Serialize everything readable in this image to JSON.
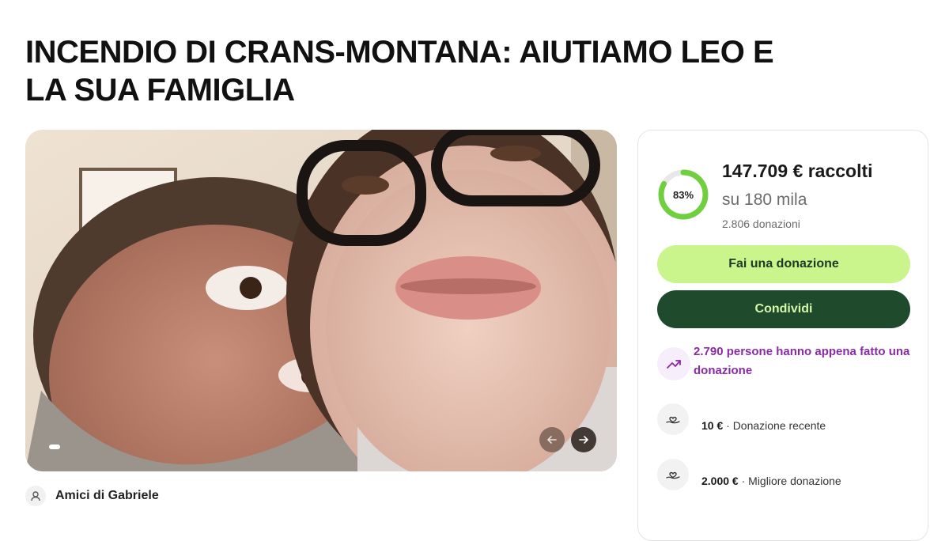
{
  "title": "INCENDIO DI CRANS-MONTANA: AIUTIAMO LEO E LA SUA FAMIGLIA",
  "hero": {
    "image_icon": "photo-selfie",
    "prev_icon": "arrow-left-icon",
    "next_icon": "arrow-right-icon",
    "slide_count_visible": 1
  },
  "organizer": {
    "name": "Amici di Gabriele",
    "icon": "user-icon"
  },
  "progress": {
    "percent_label": "83%",
    "percent_value": 83,
    "raised": "147.709 € raccolti",
    "goal": "su 180 mila",
    "donations": "2.806 donazioni"
  },
  "buttons": {
    "donate": "Fai una donazione",
    "share": "Condividi"
  },
  "trend": {
    "text": "2.790 persone hanno appena fatto una donazione",
    "icon": "trending-up-icon"
  },
  "recent": [
    {
      "amount": "10 €",
      "label": " · Donazione recente",
      "icon": "heart-hand-icon"
    },
    {
      "amount": "2.000 €",
      "label": " · Migliore donazione",
      "icon": "heart-hand-icon"
    }
  ],
  "colors": {
    "accent_green": "#6fcf3f",
    "donate_button": "#c9f58c",
    "share_button": "#1f4a2c",
    "trend_purple": "#8a2aa8"
  }
}
